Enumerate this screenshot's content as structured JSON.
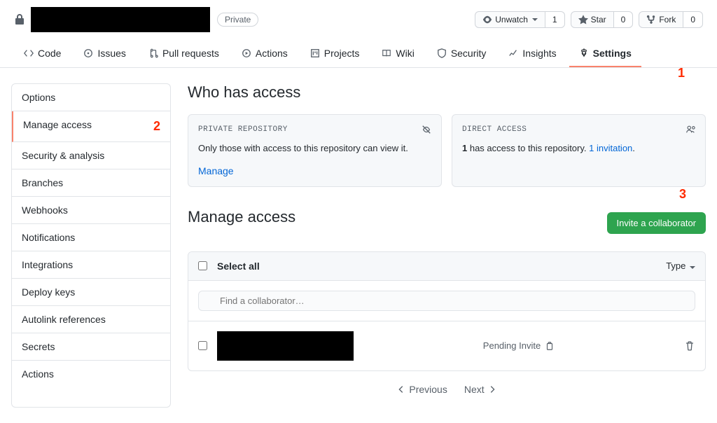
{
  "header": {
    "private_badge": "Private",
    "unwatch": {
      "label": "Unwatch",
      "count": "1"
    },
    "star": {
      "label": "Star",
      "count": "0"
    },
    "fork": {
      "label": "Fork",
      "count": "0"
    }
  },
  "tabs": [
    {
      "label": "Code"
    },
    {
      "label": "Issues"
    },
    {
      "label": "Pull requests"
    },
    {
      "label": "Actions"
    },
    {
      "label": "Projects"
    },
    {
      "label": "Wiki"
    },
    {
      "label": "Security"
    },
    {
      "label": "Insights"
    },
    {
      "label": "Settings"
    }
  ],
  "sidebar": {
    "items": [
      "Options",
      "Manage access",
      "Security & analysis",
      "Branches",
      "Webhooks",
      "Notifications",
      "Integrations",
      "Deploy keys",
      "Autolink references",
      "Secrets",
      "Actions"
    ]
  },
  "access": {
    "heading": "Who has access",
    "private_card": {
      "title": "PRIVATE REPOSITORY",
      "body": "Only those with access to this repository can view it.",
      "manage": "Manage"
    },
    "direct_card": {
      "title": "DIRECT ACCESS",
      "count": "1",
      "body_pre": " has access to this repository. ",
      "inv_count": "1",
      "inv_text": " invitation"
    }
  },
  "manage": {
    "heading": "Manage access",
    "invite_btn": "Invite a collaborator",
    "select_all": "Select all",
    "type_label": "Type",
    "search_placeholder": "Find a collaborator…",
    "pending": "Pending Invite",
    "prev": "Previous",
    "next": "Next"
  },
  "callouts": {
    "one": "1",
    "two": "2",
    "three": "3"
  }
}
